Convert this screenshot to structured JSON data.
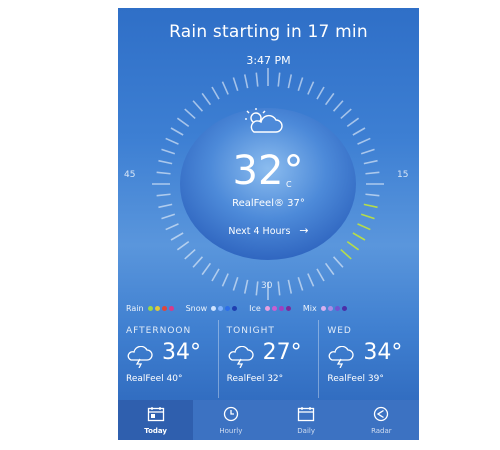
{
  "header": {
    "headline": "Rain starting in 17 min",
    "time": "3:47 PM"
  },
  "dial": {
    "label_left": "45",
    "label_right": "15",
    "label_bottom": "30"
  },
  "current": {
    "temp": "32°",
    "unit": "C",
    "realfeel": "RealFeel® 37°",
    "next": "Next 4 Hours"
  },
  "legend": [
    {
      "label": "Rain",
      "colors": [
        "#9bd84a",
        "#e2c93a",
        "#e0463a",
        "#d83a8a"
      ]
    },
    {
      "label": "Snow",
      "colors": [
        "#cfe3ff",
        "#7fb2ff",
        "#2e6fe8",
        "#1f3fb0"
      ]
    },
    {
      "label": "Ice",
      "colors": [
        "#e7a0e0",
        "#c95fd0",
        "#a03fc0",
        "#7c2a9c"
      ]
    },
    {
      "label": "Mix",
      "colors": [
        "#d7b0f0",
        "#a98ae6",
        "#6f56d0",
        "#4a2fa8"
      ]
    }
  ],
  "forecast": [
    {
      "title": "AFTERNOON",
      "temp": "34°",
      "realfeel": "RealFeel 40°"
    },
    {
      "title": "TONIGHT",
      "temp": "27°",
      "realfeel": "RealFeel 32°"
    },
    {
      "title": "WED",
      "temp": "34°",
      "realfeel": "RealFeel 39°"
    }
  ],
  "tabs": [
    {
      "label": "Today",
      "icon": "calendar-today-icon",
      "active": true
    },
    {
      "label": "Hourly",
      "icon": "clock-icon",
      "active": false
    },
    {
      "label": "Daily",
      "icon": "calendar-icon",
      "active": false
    },
    {
      "label": "Radar",
      "icon": "radar-icon",
      "active": false
    }
  ]
}
